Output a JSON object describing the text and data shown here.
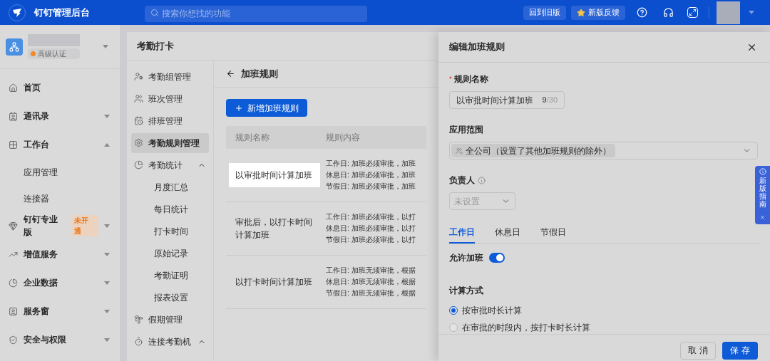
{
  "topbar": {
    "app_title": "钉钉管理后台",
    "search": {
      "placeholder": "搜索你想找的功能"
    },
    "buttons": [
      "回到旧版",
      "新版反馈"
    ]
  },
  "org": {
    "badge": "高级认证"
  },
  "sidebar": {
    "items": [
      {
        "label": "首页",
        "kind": "link"
      },
      {
        "label": "通讯录",
        "kind": "group",
        "expanded": false
      },
      {
        "label": "工作台",
        "kind": "group",
        "expanded": true,
        "children": [
          {
            "label": "应用管理"
          },
          {
            "label": "连接器"
          }
        ]
      },
      {
        "label": "钉钉专业版",
        "kind": "group",
        "expanded": false,
        "badge": "未开通"
      },
      {
        "label": "增值服务",
        "kind": "group",
        "expanded": false
      },
      {
        "label": "企业数据",
        "kind": "group",
        "expanded": false
      },
      {
        "label": "服务窗",
        "kind": "group",
        "expanded": false
      },
      {
        "label": "安全与权限",
        "kind": "group",
        "expanded": false
      }
    ]
  },
  "page": {
    "title": "考勤打卡"
  },
  "subnav": {
    "items": [
      {
        "label": "考勤组管理",
        "kind": "link",
        "selected": false
      },
      {
        "label": "班次管理",
        "kind": "link",
        "selected": false
      },
      {
        "label": "排班管理",
        "kind": "link",
        "selected": false
      },
      {
        "label": "考勤规则管理",
        "kind": "link",
        "selected": true
      },
      {
        "label": "考勤统计",
        "kind": "group",
        "expanded": true,
        "children": [
          {
            "label": "月度汇总"
          },
          {
            "label": "每日统计"
          },
          {
            "label": "打卡时间"
          },
          {
            "label": "原始记录"
          },
          {
            "label": "考勤证明"
          },
          {
            "label": "报表设置"
          }
        ]
      },
      {
        "label": "假期管理",
        "kind": "link",
        "selected": false
      },
      {
        "label": "连接考勤机",
        "kind": "group",
        "expanded": true
      }
    ]
  },
  "content": {
    "title": "加班规则",
    "add_button": "新增加班规则",
    "table": {
      "columns": [
        "规则名称",
        "规则内容"
      ],
      "rows": [
        {
          "name": "以审批时间计算加班",
          "highlighted": true,
          "content": [
            "工作日: 加班必须审批，加班",
            "休息日: 加班必须审批，加班",
            "节假日: 加班必须审批，加班"
          ]
        },
        {
          "name": "审批后，以打卡时间计算加班",
          "highlighted": false,
          "content": [
            "工作日: 加班必须审批，以打",
            "休息日: 加班必须审批，以打",
            "节假日: 加班必须审批，以打"
          ]
        },
        {
          "name": "以打卡时间计算加班",
          "highlighted": false,
          "content": [
            "工作日: 加班无须审批，根据",
            "休息日: 加班无须审批，根据",
            "节假日: 加班无须审批，根据"
          ]
        }
      ]
    }
  },
  "drawer": {
    "title": "编辑加班规则",
    "rule_name": {
      "label": "规则名称",
      "required_mark": "*",
      "value": "以审批时间计算加班",
      "count": "9",
      "max": "/30"
    },
    "scope": {
      "label": "应用范围",
      "tag": "全公司（设置了其他加班规则的除外）"
    },
    "owner": {
      "label": "负责人",
      "placeholder": "未设置"
    },
    "tabs": [
      {
        "label": "工作日",
        "selected": true
      },
      {
        "label": "休息日",
        "selected": false
      },
      {
        "label": "节假日",
        "selected": false
      }
    ],
    "allow_overtime": {
      "label": "允许加班",
      "on": true
    },
    "calc": {
      "label": "计算方式",
      "options": [
        {
          "label": "按审批时长计算",
          "selected": true
        },
        {
          "label": "在审批的时段内，按打卡时长计算",
          "selected": false
        }
      ]
    },
    "buttons": {
      "cancel": "取 消",
      "save": "保 存"
    }
  },
  "guide": {
    "label": "新版指南",
    "close": "×"
  }
}
